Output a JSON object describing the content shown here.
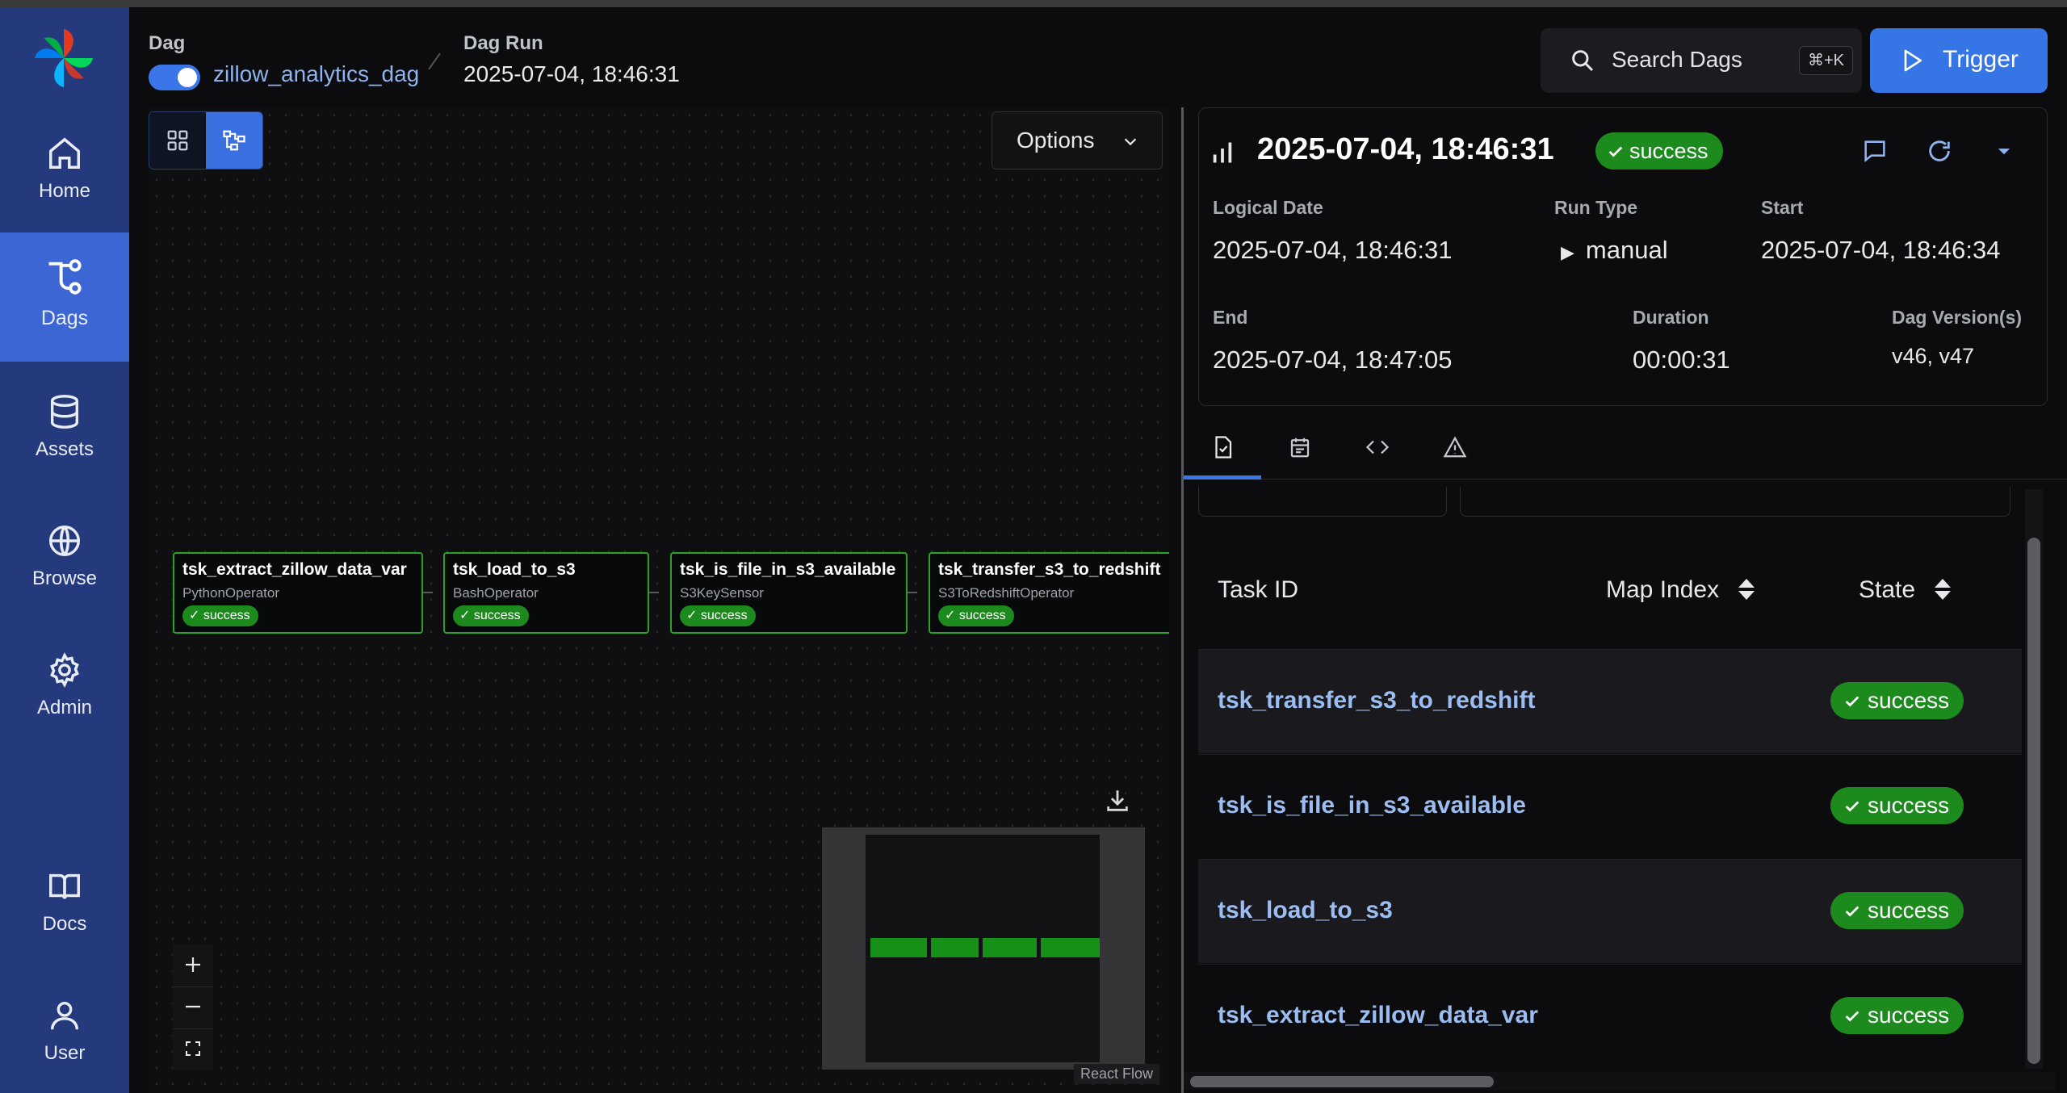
{
  "sidebar": {
    "items": [
      {
        "label": "Home",
        "icon": "home-icon"
      },
      {
        "label": "Dags",
        "icon": "dags-icon",
        "active": true
      },
      {
        "label": "Assets",
        "icon": "database-icon"
      },
      {
        "label": "Browse",
        "icon": "globe-icon"
      },
      {
        "label": "Admin",
        "icon": "gear-icon"
      },
      {
        "label": "Docs",
        "icon": "book-icon"
      },
      {
        "label": "User",
        "icon": "user-icon"
      }
    ]
  },
  "header": {
    "dag_label": "Dag",
    "dag_name": "zillow_analytics_dag",
    "dag_enabled": true,
    "run_label": "Dag Run",
    "run_value": "2025-07-04, 18:46:31",
    "search_label": "Search Dags",
    "search_shortcut": "⌘+K",
    "trigger_label": "Trigger"
  },
  "graph": {
    "options_label": "Options",
    "nodes": [
      {
        "name": "tsk_extract_zillow_data_var",
        "operator": "PythonOperator",
        "state": "success"
      },
      {
        "name": "tsk_load_to_s3",
        "operator": "BashOperator",
        "state": "success"
      },
      {
        "name": "tsk_is_file_in_s3_available",
        "operator": "S3KeySensor",
        "state": "success"
      },
      {
        "name": "tsk_transfer_s3_to_redshift",
        "operator": "S3ToRedshiftOperator",
        "state": "success"
      }
    ],
    "attribution": "React Flow"
  },
  "run": {
    "title": "2025-07-04, 18:46:31",
    "state": "success",
    "logical_date_label": "Logical Date",
    "logical_date": "2025-07-04, 18:46:31",
    "run_type_label": "Run Type",
    "run_type": "manual",
    "start_label": "Start",
    "start": "2025-07-04, 18:46:34",
    "end_label": "End",
    "end": "2025-07-04, 18:47:05",
    "duration_label": "Duration",
    "duration": "00:00:31",
    "version_label": "Dag Version(s)",
    "version": "v46, v47"
  },
  "tabs": [
    {
      "icon": "task-instances-icon",
      "active": true
    },
    {
      "icon": "calendar-icon"
    },
    {
      "icon": "code-icon"
    },
    {
      "icon": "warning-icon"
    }
  ],
  "table": {
    "columns": [
      "Task ID",
      "Map Index",
      "State"
    ],
    "rows": [
      {
        "task_id": "tsk_transfer_s3_to_redshift",
        "state": "success"
      },
      {
        "task_id": "tsk_is_file_in_s3_available",
        "state": "success"
      },
      {
        "task_id": "tsk_load_to_s3",
        "state": "success"
      },
      {
        "task_id": "tsk_extract_zillow_data_var",
        "state": "success"
      }
    ]
  },
  "colors": {
    "sidebar": "#243a7d",
    "accent": "#3b76e8",
    "success": "#1d8a1d",
    "link": "#9bbdf2"
  }
}
